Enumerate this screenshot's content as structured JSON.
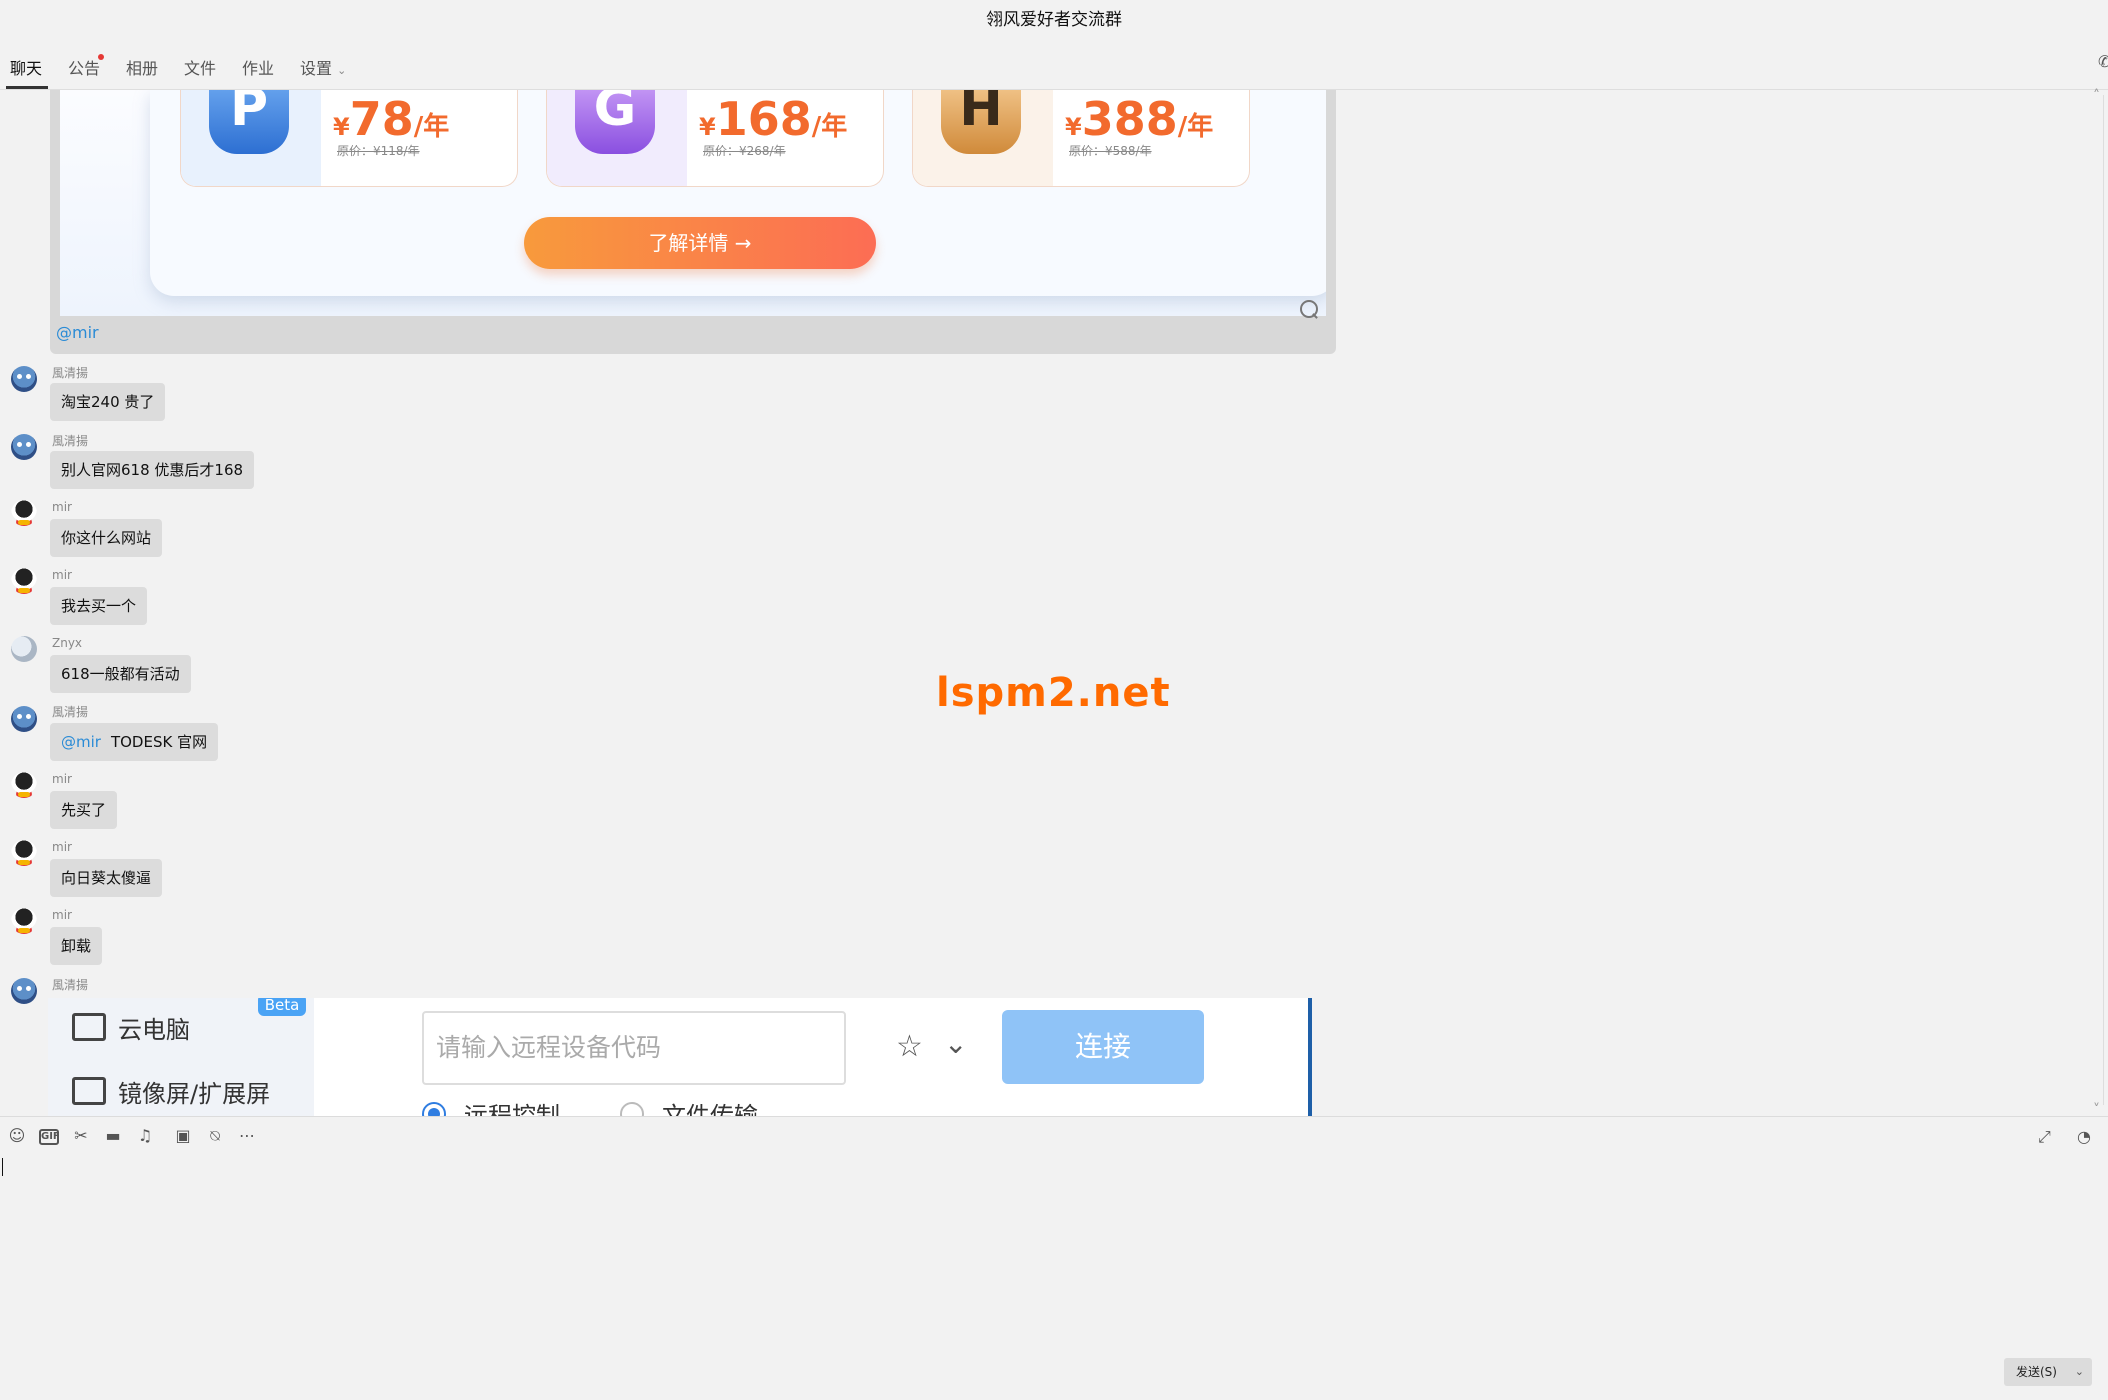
{
  "window": {
    "title": "翎风爱好者交流群"
  },
  "tabs": [
    {
      "label": "聊天"
    },
    {
      "label": "公告"
    },
    {
      "label": "相册"
    },
    {
      "label": "文件"
    },
    {
      "label": "作业"
    },
    {
      "label": "设置"
    }
  ],
  "image_card": {
    "plans": [
      {
        "badge": "P",
        "yen": "¥",
        "price": "78",
        "unit": "/年",
        "original": "原价：¥118/年"
      },
      {
        "badge": "G",
        "yen": "¥",
        "price": "168",
        "unit": "/年",
        "original": "原价：¥268/年"
      },
      {
        "badge": "H",
        "yen": "¥",
        "price": "388",
        "unit": "/年",
        "original": "原价：¥588/年"
      }
    ],
    "detail_button": "了解详情 →",
    "mention": "@mir"
  },
  "messages": [
    {
      "sender": "風清揚",
      "text": "淘宝240 贵了"
    },
    {
      "sender": "風清揚",
      "text": "别人官网618 优惠后才168"
    },
    {
      "sender": "mir",
      "text": "你这什么网站"
    },
    {
      "sender": "mir",
      "text": "我去买一个"
    },
    {
      "sender": "Znyx",
      "text": "618一般都有活动"
    },
    {
      "sender": "風清揚",
      "mention": "@mir",
      "text": "TODESK 官网"
    },
    {
      "sender": "mir",
      "text": "先买了"
    },
    {
      "sender": "mir",
      "text": "向日葵太傻逼"
    },
    {
      "sender": "mir",
      "text": "卸载"
    },
    {
      "sender": "風清揚"
    }
  ],
  "screenshot_card": {
    "beta": "Beta",
    "side_items": [
      "云电脑",
      "镜像屏/扩展屏"
    ],
    "input_placeholder": "请输入远程设备代码",
    "connect": "连接",
    "radio_remote": "远程控制",
    "radio_file": "文件传输"
  },
  "watermark": "lspm2.net",
  "composer": {
    "toolbar": [
      "emoji-icon",
      "gif-icon",
      "scissors-icon",
      "folder-icon",
      "music-icon",
      "image-icon",
      "mute-icon",
      "more-icon"
    ],
    "gif_label": "GIF",
    "send": "发送(S)"
  }
}
